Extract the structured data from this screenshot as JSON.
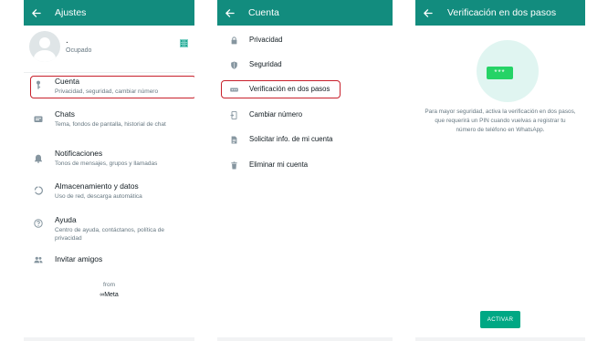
{
  "colors": {
    "appbar": "#128c7e",
    "accent": "#00a884",
    "highlight": "#c8202b",
    "icon": "#8696a0",
    "secondary_text": "#667781"
  },
  "screen1": {
    "title": "Ajustes",
    "profile": {
      "name": ".",
      "status": "Ocupado"
    },
    "items": [
      {
        "icon": "key-icon",
        "title": "Cuenta",
        "subtitle": "Privacidad, seguridad, cambiar número"
      },
      {
        "icon": "chat-icon",
        "title": "Chats",
        "subtitle": "Tema, fondos de pantalla, historial de chat"
      },
      {
        "icon": "bell-icon",
        "title": "Notificaciones",
        "subtitle": "Tonos de mensajes, grupos y llamadas"
      },
      {
        "icon": "data-usage-icon",
        "title": "Almacenamiento y datos",
        "subtitle": "Uso de red, descarga automática"
      },
      {
        "icon": "help-icon",
        "title": "Ayuda",
        "subtitle": "Centro de ayuda, contáctanos, política de privacidad"
      },
      {
        "icon": "people-icon",
        "title": "Invitar amigos",
        "subtitle": ""
      }
    ],
    "footer": {
      "from": "from",
      "brand": "∞Meta"
    }
  },
  "screen2": {
    "title": "Cuenta",
    "items": [
      {
        "icon": "lock-icon",
        "label": "Privacidad"
      },
      {
        "icon": "shield-icon",
        "label": "Seguridad"
      },
      {
        "icon": "password-dots-icon",
        "label": "Verificación en dos pasos"
      },
      {
        "icon": "phone-swap-icon",
        "label": "Cambiar número"
      },
      {
        "icon": "document-icon",
        "label": "Solicitar info. de mi cuenta"
      },
      {
        "icon": "trash-icon",
        "label": "Eliminar mi cuenta"
      }
    ]
  },
  "screen3": {
    "title": "Verificación en dos pasos",
    "illustration_text": "***",
    "description": "Para mayor seguridad, activa la verificación en dos pasos, que requerirá un PIN cuando vuelvas a registrar tu número de teléfono en WhatsApp.",
    "button": "ACTIVAR"
  }
}
